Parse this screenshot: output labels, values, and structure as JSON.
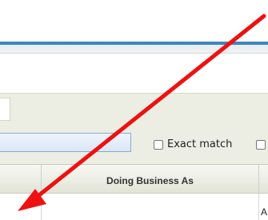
{
  "toolbar": {
    "exact_match_label": "Exact match"
  },
  "grid": {
    "columns": [
      "Doing Business As"
    ],
    "first_row_partial": "A"
  },
  "annotation": {
    "arrow_color": "#ee1111"
  }
}
